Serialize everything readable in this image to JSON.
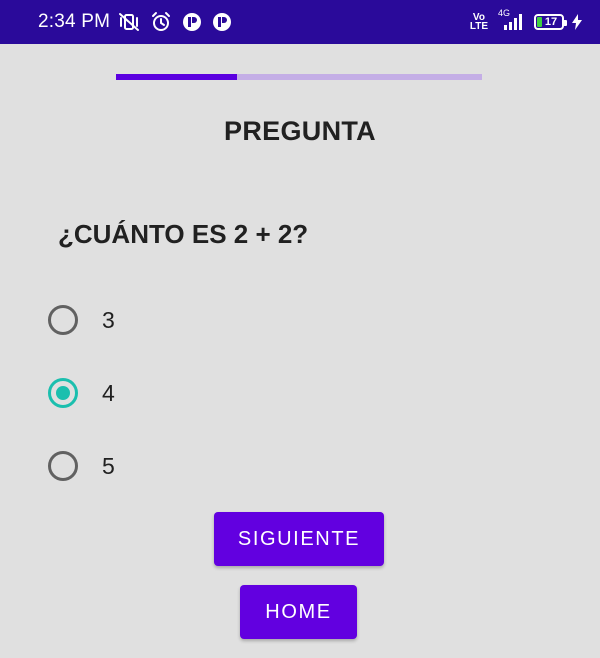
{
  "status_bar": {
    "time": "2:34 PM",
    "left_icons": [
      "vibrate-off-icon",
      "alarm-icon",
      "app-notification-icon",
      "app-notification-icon"
    ],
    "network_label": "Vo\nLTE",
    "network_type": "4G",
    "battery_level": "17",
    "charging": true,
    "background_color": "#2a0a9a"
  },
  "quiz": {
    "progress_fraction": 0.33,
    "title": "PREGUNTA",
    "question": "¿CUÁNTO ES 2 + 2?",
    "options": [
      {
        "label": "3",
        "selected": false
      },
      {
        "label": "4",
        "selected": true
      },
      {
        "label": "5",
        "selected": false
      }
    ],
    "next_button": "SIGUIENTE",
    "home_button": "HOME"
  },
  "colors": {
    "accent": "#6200e0",
    "radio_checked": "#1bbfae",
    "progress_track": "#c4aee6",
    "background": "#e0e0e0"
  }
}
